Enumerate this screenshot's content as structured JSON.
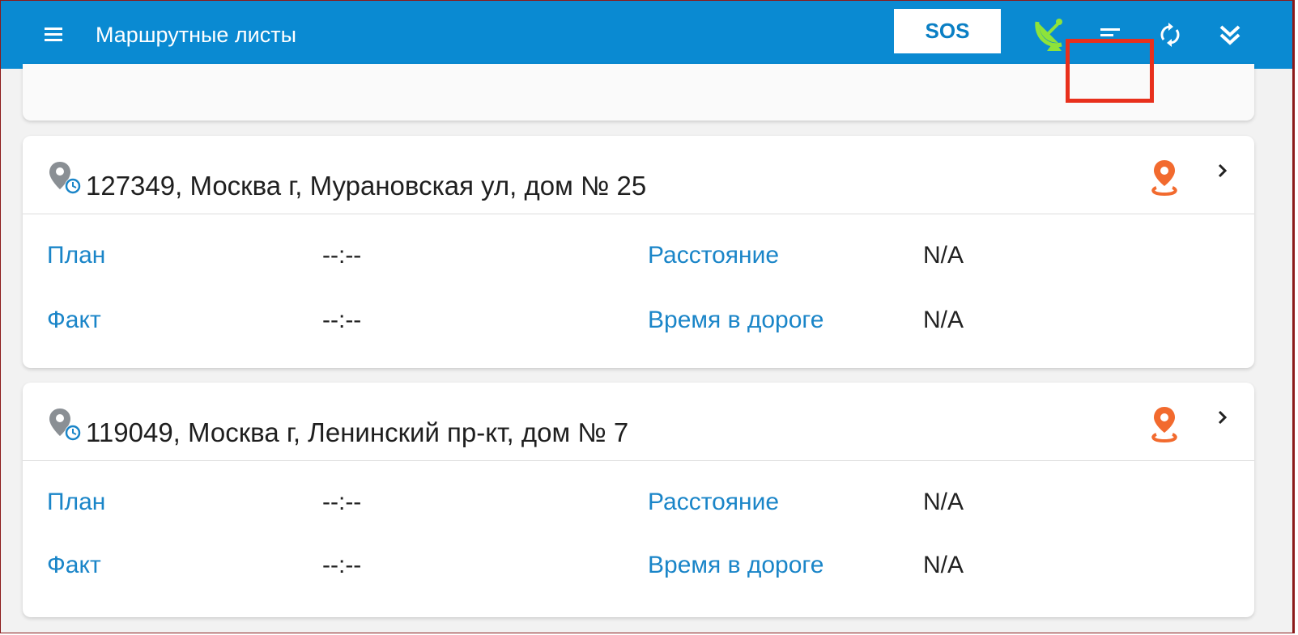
{
  "appbar": {
    "title": "Маршрутные листы",
    "sos_label": "SOS",
    "accent_color": "#0a8ad2",
    "icons": [
      "menu-icon",
      "satellite-dish-icon",
      "sort-icon",
      "sync-icon",
      "double-chevron-down-icon"
    ]
  },
  "cards": [
    {
      "address": "127349, Москва г, Мурановская ул, дом № 25",
      "plan_label": "План",
      "plan_value": "--:--",
      "fact_label": "Факт",
      "fact_value": "--:--",
      "distance_label": "Расстояние",
      "distance_value": "N/A",
      "travel_time_label": "Время в дороге",
      "travel_time_value": "N/A"
    },
    {
      "address": "119049, Москва г, Ленинский пр-кт, дом № 7",
      "plan_label": "План",
      "plan_value": "--:--",
      "fact_label": "Факт",
      "fact_value": "--:--",
      "distance_label": "Расстояние",
      "distance_value": "N/A",
      "travel_time_label": "Время в дороге",
      "travel_time_value": "N/A"
    }
  ]
}
